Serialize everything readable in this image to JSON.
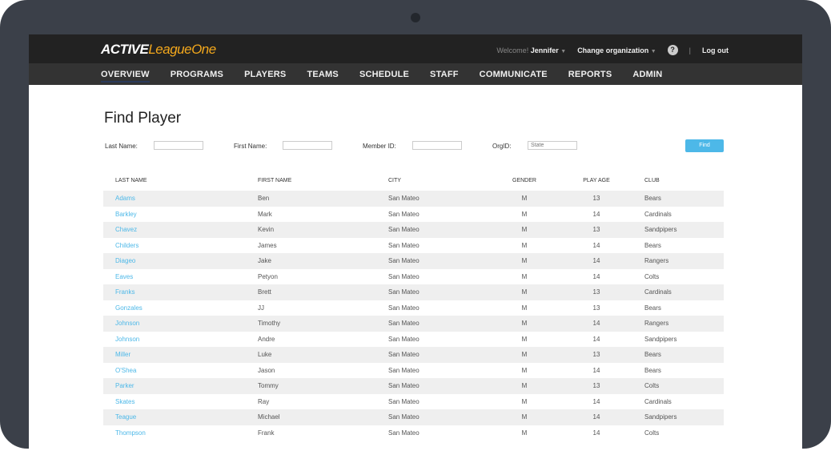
{
  "header": {
    "logo_active": "ACTIVE",
    "logo_rest": "LeagueOne",
    "welcome": "Welcome!",
    "user": "Jennifer",
    "change_org": "Change organization",
    "help": "?",
    "logout": "Log out"
  },
  "nav": [
    "OVERVIEW",
    "PROGRAMS",
    "PLAYERS",
    "TEAMS",
    "SCHEDULE",
    "STAFF",
    "COMMUNICATE",
    "REPORTS",
    "ADMIN"
  ],
  "page_title": "Find Player",
  "filters": {
    "last_name": "Last Name:",
    "first_name": "First Name:",
    "member_id": "Member ID:",
    "org_id": "OrgID:",
    "org_placeholder": "State",
    "find": "Find"
  },
  "table": {
    "headers": [
      "LAST NAME",
      "FIRST NAME",
      "CITY",
      "GENDER",
      "PLAY AGE",
      "CLUB"
    ],
    "rows": [
      [
        "Adams",
        "Ben",
        "San Mateo",
        "M",
        "13",
        "Bears"
      ],
      [
        "Barkley",
        "Mark",
        "San Mateo",
        "M",
        "14",
        "Cardinals"
      ],
      [
        "Chavez",
        "Kevin",
        "San Mateo",
        "M",
        "13",
        "Sandpipers"
      ],
      [
        "Childers",
        "James",
        "San Mateo",
        "M",
        "14",
        "Bears"
      ],
      [
        "Diageo",
        "Jake",
        "San Mateo",
        "M",
        "14",
        "Rangers"
      ],
      [
        "Eaves",
        "Petyon",
        "San Mateo",
        "M",
        "14",
        "Colts"
      ],
      [
        "Franks",
        "Brett",
        "San Mateo",
        "M",
        "13",
        "Cardinals"
      ],
      [
        "Gonzales",
        "JJ",
        "San Mateo",
        "M",
        "13",
        "Bears"
      ],
      [
        "Johnson",
        "Timothy",
        "San Mateo",
        "M",
        "14",
        "Rangers"
      ],
      [
        "Johnson",
        "Andre",
        "San Mateo",
        "M",
        "14",
        "Sandpipers"
      ],
      [
        "Miller",
        "Luke",
        "San Mateo",
        "M",
        "13",
        "Bears"
      ],
      [
        "O'Shea",
        "Jason",
        "San Mateo",
        "M",
        "14",
        "Bears"
      ],
      [
        "Parker",
        "Tommy",
        "San Mateo",
        "M",
        "13",
        "Colts"
      ],
      [
        "Skates",
        "Ray",
        "San Mateo",
        "M",
        "14",
        "Cardinals"
      ],
      [
        "Teague",
        "Michael",
        "San Mateo",
        "M",
        "14",
        "Sandpipers"
      ],
      [
        "Thompson",
        "Frank",
        "San Mateo",
        "M",
        "14",
        "Colts"
      ]
    ]
  }
}
